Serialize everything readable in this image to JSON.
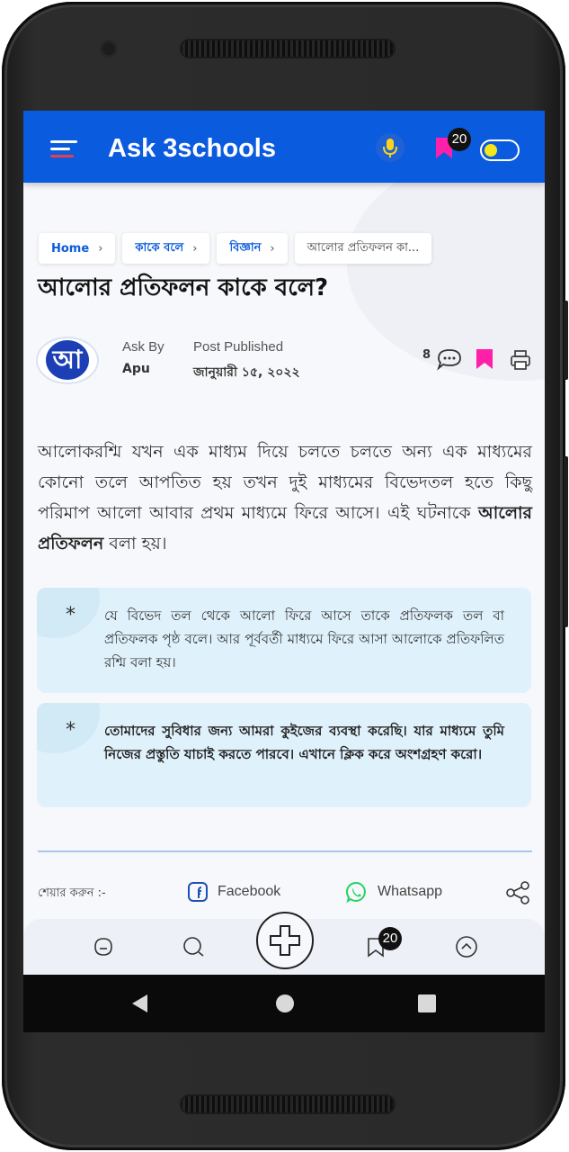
{
  "appbar": {
    "title": "Ask 3schools",
    "bookmark_count": "20"
  },
  "breadcrumb": [
    {
      "label": "Home",
      "sep": "›"
    },
    {
      "label": "কাকে বলে",
      "sep": "›"
    },
    {
      "label": "বিজ্ঞান",
      "sep": "›"
    },
    {
      "label": "আলোর প্রতিফলন কা..."
    }
  ],
  "post": {
    "title": "আলোর প্রতিফলন কাকে বলে?",
    "author_avatar_letter": "আ",
    "ask_by_label": "Ask By",
    "author": "Apu",
    "published_label": "Post Published",
    "published_date": "জানুয়ারী ১৫, ২০২২",
    "comment_count": "8",
    "body_before": "আলোকরশ্মি যখন এক মাধ্যম দিয়ে চলতে চলতে অন্য এক মাধ্যমের কোনো তলে আপতিত হয় তখন দুই মাধ্যমের বিভেদতল হতে কিছু পরিমাপ আলো আবার প্রথম মাধ্যমে ফিরে আসে। এই ঘটনাকে ",
    "body_bold": "আলোর প্রতিফলন",
    "body_after": " বলা হয়।"
  },
  "notes": [
    {
      "marker": "*",
      "text": "যে বিভেদ তল থেকে আলো ফিরে আসে তাকে প্রতিফলক তল বা প্রতিফলক পৃষ্ঠ বলে। আর পূর্ববর্তী মাধ্যমে ফিরে আসা আলোকে প্রতিফলিত রশ্মি বলা হয়।"
    },
    {
      "marker": "*",
      "text": "তোমাদের সুবিধার জন্য আমরা কুইজের ব্যবস্থা করেছি। যার মাধ্যমে তুমি নিজের প্রস্তুতি যাচাই করতে পারবে। এখানে ক্লিক করে অংশগ্রহণ করো।"
    }
  ],
  "share": {
    "label": "শেয়ার করুন :-",
    "facebook": "Facebook",
    "whatsapp": "Whatsapp"
  },
  "bottom_nav": {
    "bookmark_count": "20"
  },
  "colors": {
    "primary": "#0b5bde",
    "bookmark": "#ff1fa8",
    "note_bg": "#dff1fb",
    "whatsapp": "#25d366"
  },
  "icons": [
    "menu-icon",
    "mic-icon",
    "bookmark-icon",
    "theme-toggle-icon",
    "comment-icon",
    "print-icon",
    "facebook-icon",
    "whatsapp-icon",
    "share-icon",
    "home-icon",
    "search-icon",
    "add-icon",
    "chevron-up-icon",
    "back-icon",
    "home-button-icon",
    "recents-icon"
  ]
}
